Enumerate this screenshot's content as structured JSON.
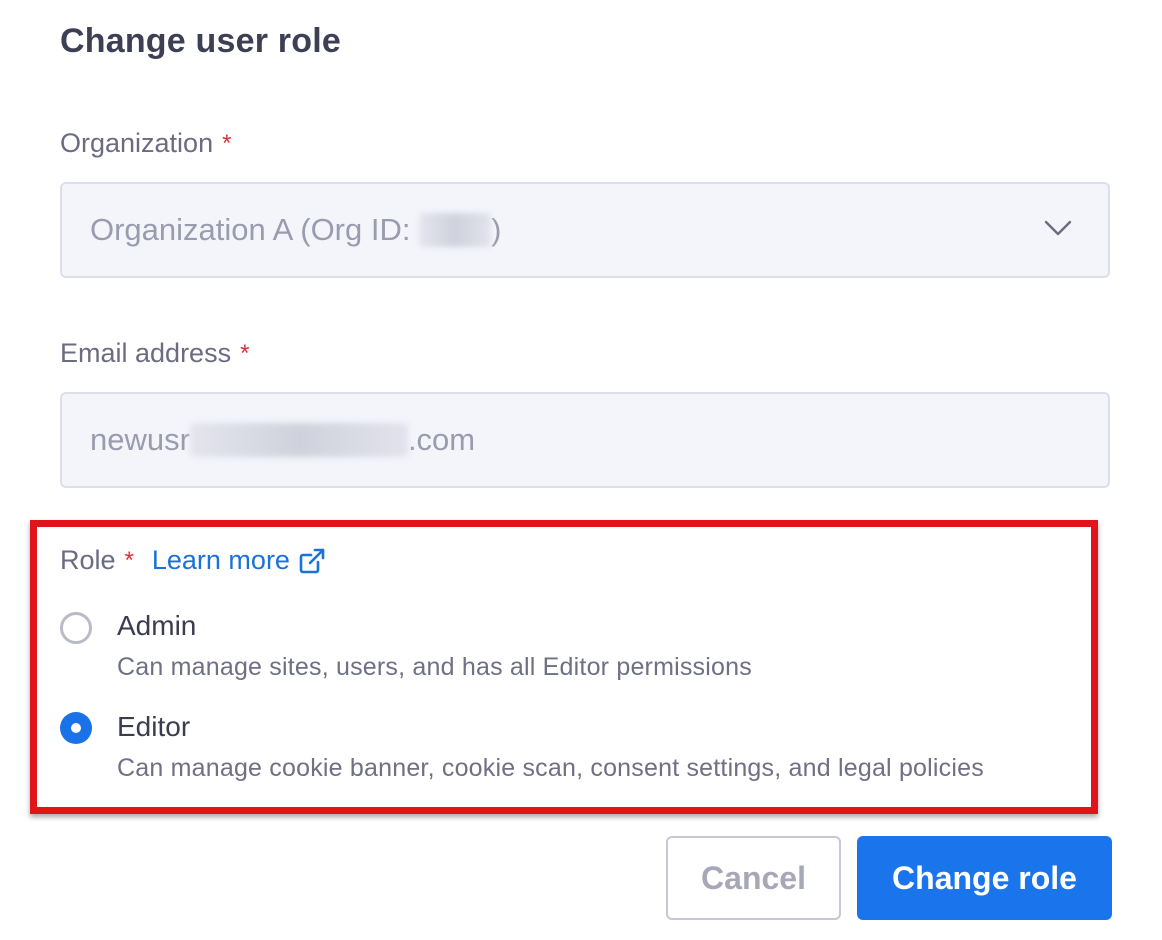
{
  "dialog": {
    "title": "Change user role"
  },
  "organization": {
    "label": "Organization",
    "required_mark": "*",
    "value_prefix": "Organization A (Org ID: ",
    "value_suffix": ")"
  },
  "email": {
    "label": "Email address",
    "required_mark": "*",
    "value_prefix": "newusr",
    "value_suffix": ".com"
  },
  "role": {
    "label": "Role",
    "required_mark": "*",
    "learn_more": "Learn more",
    "options": [
      {
        "title": "Admin",
        "description": "Can manage sites, users, and has all Editor permissions",
        "selected": false
      },
      {
        "title": "Editor",
        "description": "Can manage cookie banner, cookie scan, consent settings, and legal policies",
        "selected": true
      }
    ]
  },
  "buttons": {
    "cancel": "Cancel",
    "submit": "Change role"
  },
  "colors": {
    "accent": "#1a72e8",
    "required": "#d6323c",
    "highlight_border": "#e0141b"
  },
  "icons": {
    "organization_dropdown": "chevron-down-icon",
    "learn_more": "external-link-icon"
  }
}
